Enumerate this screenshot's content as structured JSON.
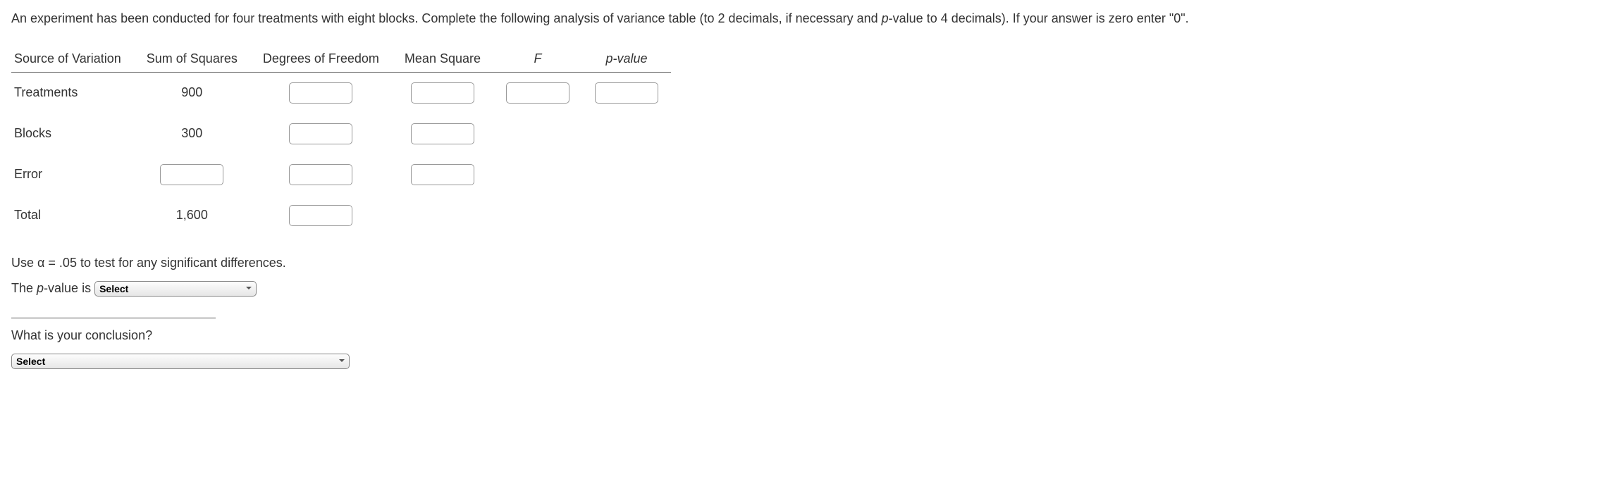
{
  "intro": "An experiment has been conducted for four treatments with eight blocks. Complete the following analysis of variance table (to 2 decimals, if necessary and ",
  "intro_pvalue": "p",
  "intro2": "-value to 4 decimals). If your answer is zero enter \"0\".",
  "headers": {
    "source": "Source of Variation",
    "ss": "Sum of Squares",
    "df": "Degrees of Freedom",
    "ms": "Mean Square",
    "f": "F",
    "p": "p-value"
  },
  "rows": {
    "treatments": {
      "label": "Treatments",
      "ss": "900"
    },
    "blocks": {
      "label": "Blocks",
      "ss": "300"
    },
    "error": {
      "label": "Error"
    },
    "total": {
      "label": "Total",
      "ss": "1,600"
    }
  },
  "use_alpha": "Use α = .05 to test for any significant differences.",
  "pvalue_line_1": "The ",
  "pvalue_line_p": "p",
  "pvalue_line_2": "-value is",
  "select_label": "Select",
  "conclusion_q": "What is your conclusion?"
}
